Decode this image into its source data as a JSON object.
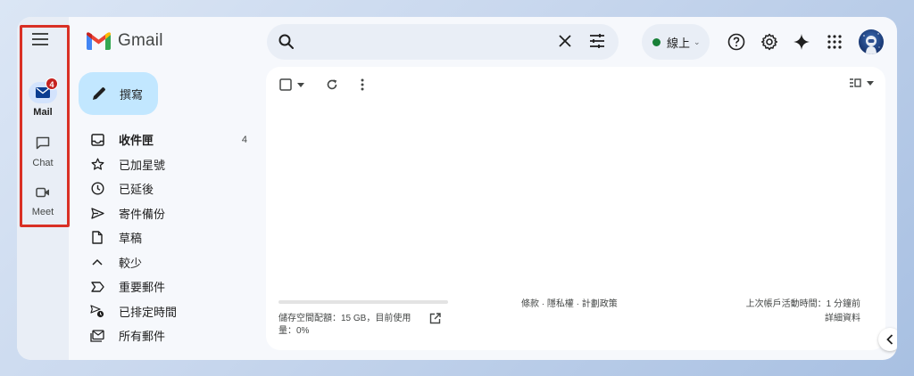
{
  "app": {
    "name": "Gmail"
  },
  "rail": {
    "items": [
      {
        "label": "Mail",
        "badge": "4",
        "active": true
      },
      {
        "label": "Chat"
      },
      {
        "label": "Meet"
      }
    ]
  },
  "header": {
    "status_label": "線上"
  },
  "compose": {
    "label": "撰寫"
  },
  "nav": {
    "items": [
      {
        "label": "收件匣",
        "count": "4",
        "icon": "inbox-icon"
      },
      {
        "label": "已加星號",
        "icon": "star-icon"
      },
      {
        "label": "已延後",
        "icon": "clock-icon"
      },
      {
        "label": "寄件備份",
        "icon": "send-icon"
      },
      {
        "label": "草稿",
        "icon": "draft-icon"
      },
      {
        "label": "較少",
        "icon": "chevron-up-icon"
      },
      {
        "label": "重要郵件",
        "icon": "important-icon"
      },
      {
        "label": "已排定時間",
        "icon": "scheduled-icon"
      },
      {
        "label": "所有郵件",
        "icon": "all-mail-icon"
      }
    ]
  },
  "footer": {
    "quota": "儲存空間配額：15 GB，目前使用量：0%",
    "links": "條款 · 隱私權 · 計劃政策",
    "activity": "上次帳戶活動時間：1 分鐘前",
    "details": "詳細資料"
  },
  "colors": {
    "accent": "#0b57d0",
    "compose_bg": "#c2e7ff",
    "badge": "#c5221f",
    "highlight": "#d93025",
    "online": "#188038"
  }
}
